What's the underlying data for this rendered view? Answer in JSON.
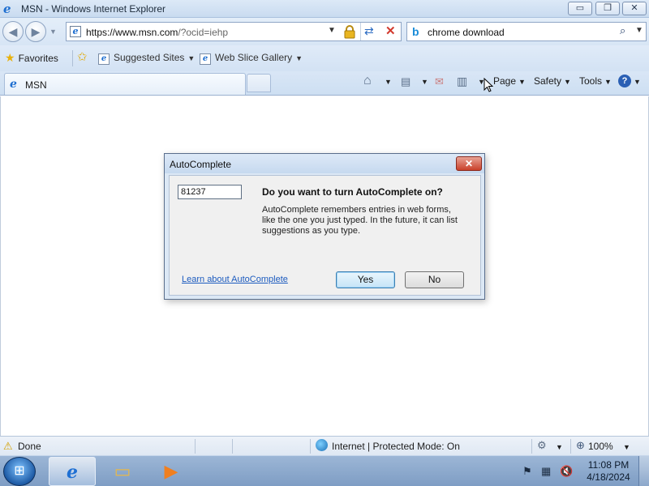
{
  "window": {
    "title": "MSN - Windows Internet Explorer",
    "minimize_glyph": "▭",
    "maximize_glyph": "❐",
    "close_glyph": "✕"
  },
  "address_bar": {
    "url_main": "https://www.msn.com",
    "url_rest": "/?ocid=iehp"
  },
  "search": {
    "value": "chrome download"
  },
  "favorites_bar": {
    "favorites_label": "Favorites",
    "links": [
      {
        "label": "Suggested Sites"
      },
      {
        "label": "Web Slice Gallery"
      }
    ]
  },
  "tabs": [
    {
      "label": "MSN",
      "active": true
    }
  ],
  "command_bar": {
    "page_label": "Page",
    "safety_label": "Safety",
    "tools_label": "Tools",
    "help_glyph": "?"
  },
  "dialog": {
    "title": "AutoComplete",
    "field_value": "81237",
    "question": "Do you want to turn AutoComplete on?",
    "description": "AutoComplete remembers entries in web forms, like the one you just typed. In the future, it can list suggestions as you type.",
    "learn_link": "Learn about AutoComplete",
    "yes_label": "Yes",
    "no_label": "No"
  },
  "status_bar": {
    "status": "Done",
    "zone": "Internet | Protected Mode: On",
    "zoom": "100%"
  },
  "taskbar": {
    "time": "11:08 PM",
    "date": "4/18/2024"
  },
  "colors": {
    "accent": "#1f6fd0",
    "close_red": "#c9402a",
    "link_blue": "#1c5bbf"
  }
}
